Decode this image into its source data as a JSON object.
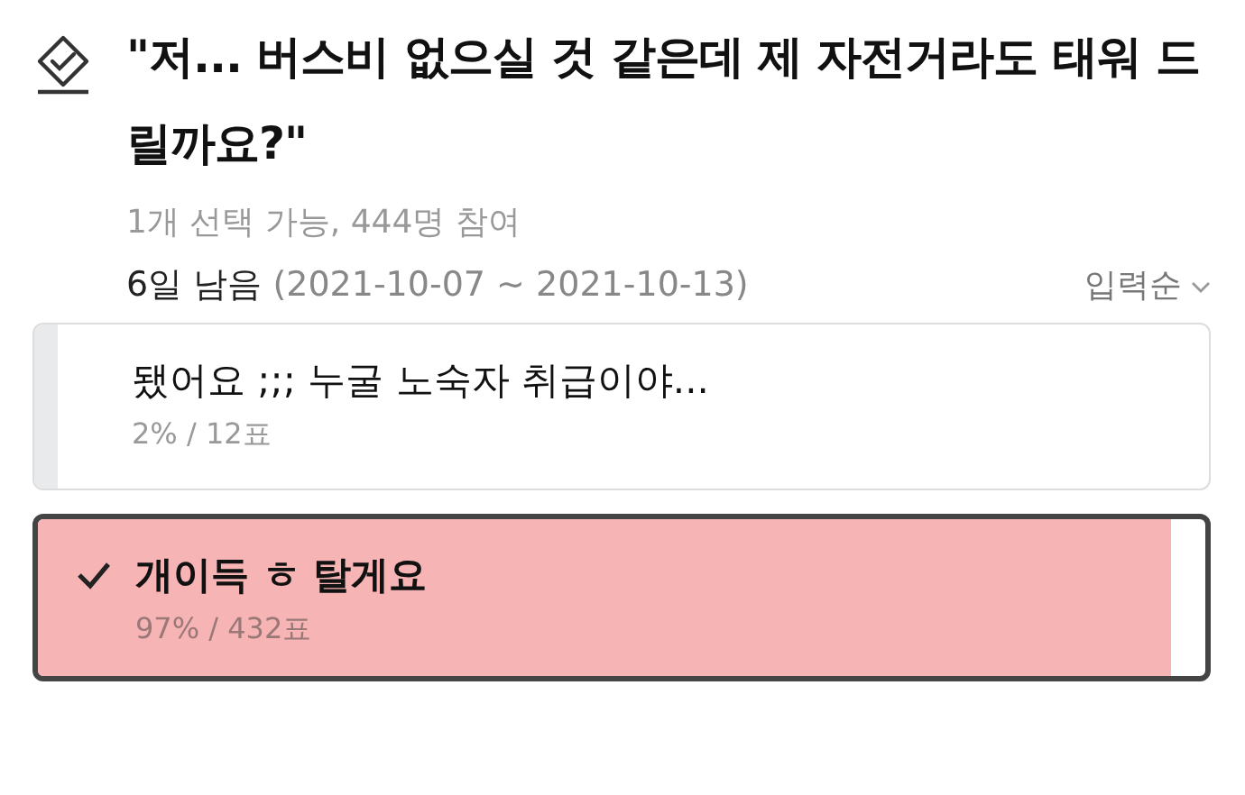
{
  "poll": {
    "title": "\"저... 버스비 없으실 것 같은데 제 자전거라도 태워 드릴까요?\"",
    "info": "1개 선택 가능, 444명 참여",
    "remaining": "6일 남음",
    "period": "(2021-10-07 ~ 2021-10-13)",
    "sort": "입력순",
    "options": [
      {
        "label": "됐어요 ;;; 누굴 노숙자 취급이야...",
        "result": "2% / 12표",
        "level": 0.02,
        "selected": false
      },
      {
        "label": "개이득 ㅎ 탈게요",
        "result": "97% / 432표",
        "level": 0.97,
        "selected": true
      }
    ]
  }
}
